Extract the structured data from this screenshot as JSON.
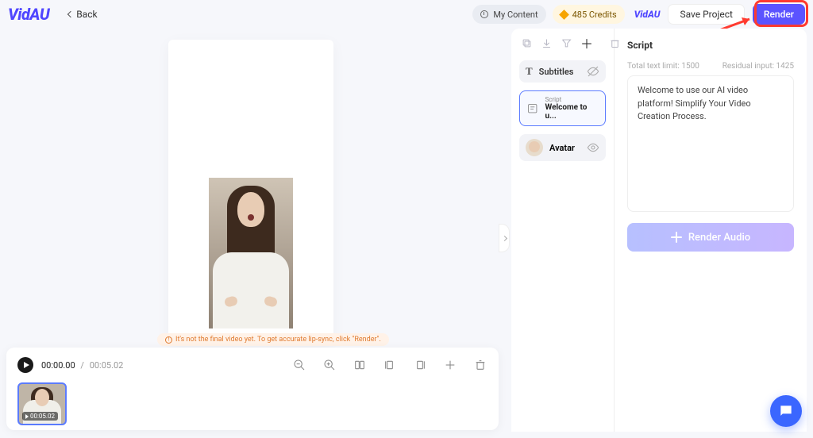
{
  "brand": {
    "logo": "VidAU",
    "mini": "VidAU"
  },
  "header": {
    "back": "Back",
    "my_content": "My Content",
    "credits": "485 Credits",
    "save": "Save Project",
    "render": "Render"
  },
  "canvas": {
    "warning": "It's not the final video yet. To get accurate lip-sync, click \"Render\"."
  },
  "timeline": {
    "current": "00:00.00",
    "separator": "/",
    "duration": "00:05.02",
    "thumb_time": "00:05.02"
  },
  "layers": {
    "subtitles": "Subtitles",
    "script_label": "Script",
    "script_preview": "Welcome to u...",
    "avatar": "Avatar"
  },
  "script": {
    "heading": "Script",
    "limit_label": "Total text limit: 1500",
    "residual_label": "Residual input: 1425",
    "text": "Welcome to use our AI video platform! Simplify Your Video Creation Process.",
    "render_audio": "Render Audio"
  }
}
